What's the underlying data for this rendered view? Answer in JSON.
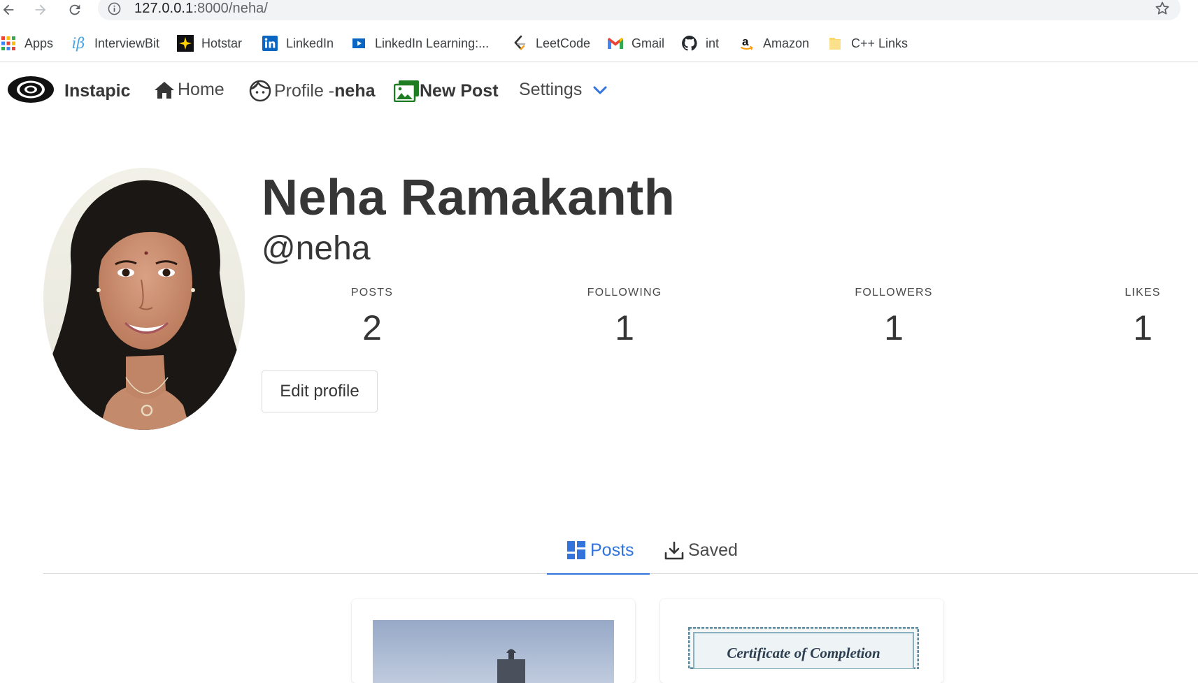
{
  "browser": {
    "url_host": "127.0.0.1",
    "url_path": ":8000/neha/",
    "bookmarks": [
      {
        "label": "Apps",
        "icon": "apps-grid-icon"
      },
      {
        "label": "InterviewBit",
        "icon": "interviewbit-icon"
      },
      {
        "label": "Hotstar",
        "icon": "hotstar-icon"
      },
      {
        "label": "LinkedIn",
        "icon": "linkedin-icon"
      },
      {
        "label": "LinkedIn Learning:...",
        "icon": "linkedin-learning-icon"
      },
      {
        "label": "LeetCode",
        "icon": "leetcode-icon"
      },
      {
        "label": "Gmail",
        "icon": "gmail-icon"
      },
      {
        "label": "int",
        "icon": "github-icon"
      },
      {
        "label": "Amazon",
        "icon": "amazon-icon"
      },
      {
        "label": "C++ Links",
        "icon": "folder-icon"
      }
    ]
  },
  "navbar": {
    "brand": "Instapic",
    "home": "Home",
    "profile_prefix": "Profile -",
    "profile_user": "neha",
    "new_post": "New Post",
    "settings": "Settings"
  },
  "profile": {
    "full_name": "Neha Ramakanth",
    "handle": "@neha",
    "stats": [
      {
        "label": "POSTS",
        "value": "2"
      },
      {
        "label": "FOLLOWING",
        "value": "1"
      },
      {
        "label": "FOLLOWERS",
        "value": "1"
      },
      {
        "label": "LIKES",
        "value": "1"
      }
    ],
    "edit_button": "Edit profile"
  },
  "tabs": {
    "posts": "Posts",
    "saved": "Saved"
  },
  "posts": [
    {
      "alt": "building photo"
    },
    {
      "caption": "Certificate of Completion"
    }
  ],
  "colors": {
    "accent": "#3273dc",
    "new_post_green": "#1e7d22",
    "text": "#363636"
  }
}
